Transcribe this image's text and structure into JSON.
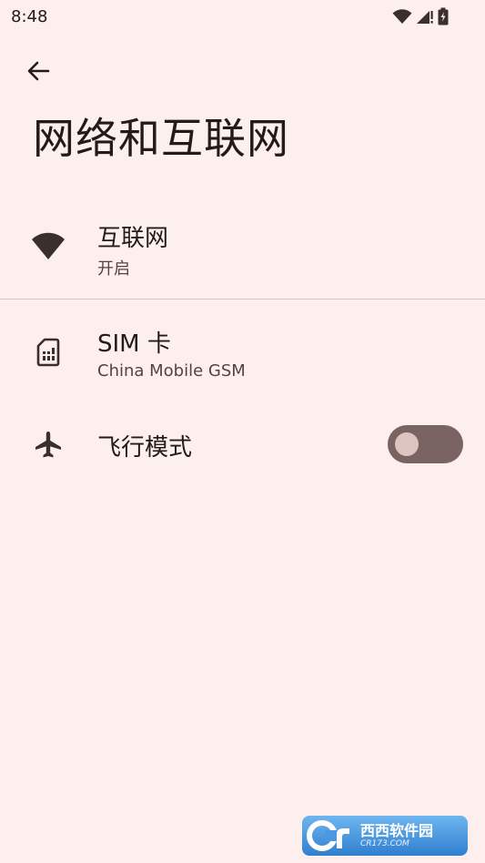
{
  "status_bar": {
    "time": "8:48",
    "icons": [
      "wifi-icon",
      "signal-icon",
      "battery-icon"
    ]
  },
  "header": {
    "back_icon": "back-arrow-icon",
    "title": "网络和互联网"
  },
  "items": [
    {
      "icon": "wifi-icon",
      "title": "互联网",
      "subtitle": "开启"
    },
    {
      "icon": "sim-card-icon",
      "title": "SIM 卡",
      "subtitle": "China Mobile GSM"
    },
    {
      "icon": "airplane-icon",
      "title": "飞行模式",
      "toggle_on": false
    }
  ],
  "watermark": {
    "brand": "西西软件园",
    "site": "CR173.COM"
  },
  "colors": {
    "background": "#fcefee",
    "text_primary": "#231a19",
    "text_secondary": "#534341",
    "icon": "#3b2f2e",
    "divider": "#d8c2bf",
    "toggle_track": "#7a6462",
    "toggle_thumb": "#dcc4c1"
  }
}
